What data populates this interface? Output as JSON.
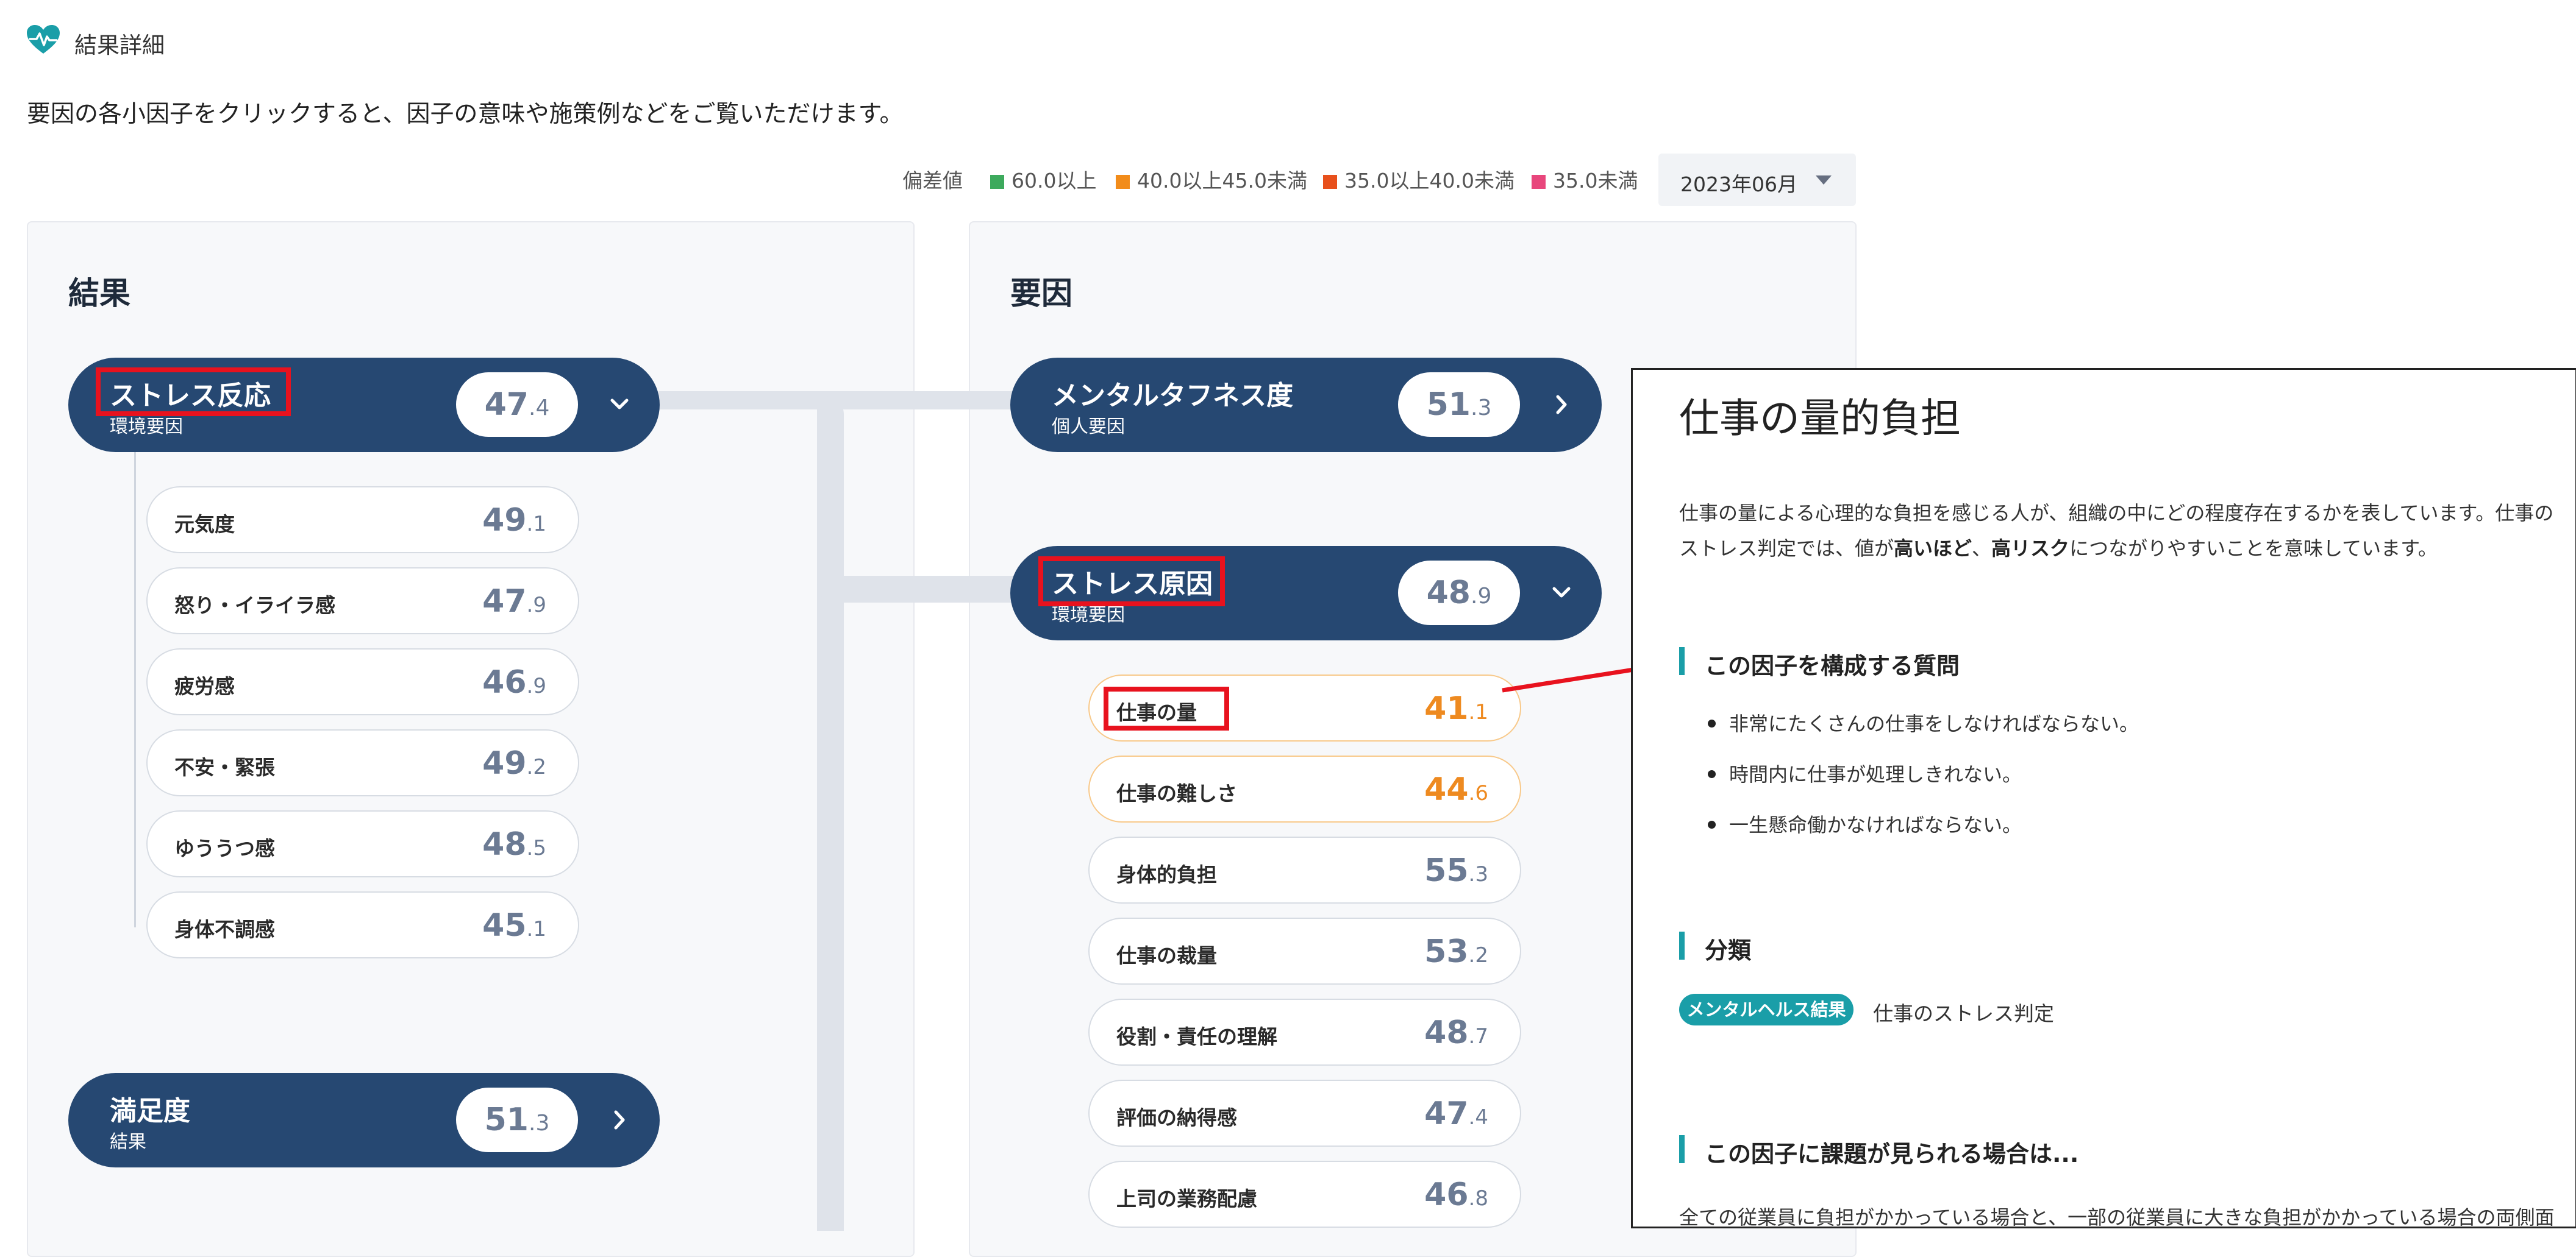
{
  "header": {
    "title": "結果詳細",
    "instruction": "要因の各小因子をクリックすると、因子の意味や施策例などをご覧いただけます。"
  },
  "legend": {
    "label": "偏差値",
    "items": [
      {
        "label": "60.0以上",
        "color": "#3daa5d"
      },
      {
        "label": "40.0以上45.0未満",
        "color": "#f28c1a"
      },
      {
        "label": "35.0以上40.0未満",
        "color": "#e8501c"
      },
      {
        "label": "35.0未満",
        "color": "#e8467c"
      }
    ]
  },
  "month_select": {
    "value": "2023年06月"
  },
  "result_panel": {
    "title": "結果",
    "stress_reaction": {
      "name": "ストレス反応",
      "sub": "環境要因",
      "score_int": "47",
      "score_dec": ".4",
      "items": [
        {
          "label": "元気度",
          "int": "49",
          "dec": ".1"
        },
        {
          "label": "怒り・イライラ感",
          "int": "47",
          "dec": ".9"
        },
        {
          "label": "疲労感",
          "int": "46",
          "dec": ".9"
        },
        {
          "label": "不安・緊張",
          "int": "49",
          "dec": ".2"
        },
        {
          "label": "ゆううつ感",
          "int": "48",
          "dec": ".5"
        },
        {
          "label": "身体不調感",
          "int": "45",
          "dec": ".1"
        }
      ]
    },
    "satisfaction": {
      "name": "満足度",
      "sub": "結果",
      "score_int": "51",
      "score_dec": ".3"
    }
  },
  "factor_panel": {
    "title": "要因",
    "mental_toughness": {
      "name": "メンタルタフネス度",
      "sub": "個人要因",
      "score_int": "51",
      "score_dec": ".3"
    },
    "stress_cause": {
      "name": "ストレス原因",
      "sub": "環境要因",
      "score_int": "48",
      "score_dec": ".9",
      "items": [
        {
          "label": "仕事の量",
          "int": "41",
          "dec": ".1"
        },
        {
          "label": "仕事の難しさ",
          "int": "44",
          "dec": ".6"
        },
        {
          "label": "身体的負担",
          "int": "55",
          "dec": ".3"
        },
        {
          "label": "仕事の裁量",
          "int": "53",
          "dec": ".2"
        },
        {
          "label": "役割・責任の理解",
          "int": "48",
          "dec": ".7"
        },
        {
          "label": "評価の納得感",
          "int": "47",
          "dec": ".4"
        },
        {
          "label": "上司の業務配慮",
          "int": "46",
          "dec": ".8"
        }
      ]
    }
  },
  "detail": {
    "title": "仕事の量的負担",
    "desc_1": "仕事の量による心理的な負担を感じる人が、組織の中にどの程度存在するかを表しています。仕事の",
    "desc_2a": "ストレス判定では、値が",
    "desc_2b": "高いほど",
    "desc_2c": "、",
    "desc_2d": "高リスク",
    "desc_2e": "につながりやすいことを意味しています。",
    "questions_heading": "この因子を構成する質問",
    "questions": [
      "非常にたくさんの仕事をしなければならない。",
      "時間内に仕事が処理しきれない。",
      "一生懸命働かなければならない。"
    ],
    "category_heading": "分類",
    "category_badge": "メンタルヘルス結果",
    "category_text": "仕事のストレス判定",
    "issue_heading": "この因子に課題が見られる場合は...",
    "issue_text": "全ての従業員に負担がかかっている場合と、一部の従業員に大きな負担がかかっている場合の両側面"
  },
  "colors": {
    "pill": "#264872",
    "warn": "#ee8a20",
    "accent": "#1a9ea8",
    "highlight": "#e8121e"
  }
}
